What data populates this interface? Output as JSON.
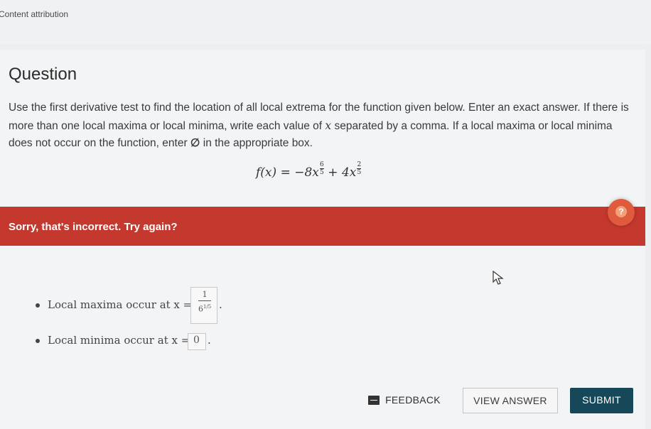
{
  "attribution": "Content attribution",
  "question": {
    "title": "Question",
    "body_1": "Use the first derivative test to find the location of all local extrema for the function given below. Enter an exact answer. If there is more than one local maxima or local minima, write each value of ",
    "body_var": "x",
    "body_2": " separated by a comma. If a local maxima or local minima does not occur on the function, enter ",
    "body_empty": "∅",
    "body_3": " in the appropriate box.",
    "formula": {
      "lhs": "f(x)",
      "eq": "=",
      "term1_coef": "−8x",
      "term1_exp_num": "6",
      "term1_exp_den": "5",
      "plus": "+",
      "term2_coef": "4x",
      "term2_exp_num": "2",
      "term2_exp_den": "5"
    }
  },
  "feedback": {
    "message": "Sorry, that's incorrect. Try again?",
    "help_label": "?"
  },
  "answers": {
    "maxima_label": "Local maxima occur at x =",
    "maxima_value_num": "1",
    "maxima_value_den": "6",
    "maxima_value_den_exp": "1/5",
    "maxima_suffix": ".",
    "minima_label": "Local minima occur at x =",
    "minima_value": "0",
    "minima_suffix": "."
  },
  "buttons": {
    "feedback": "FEEDBACK",
    "view_answer": "VIEW ANSWER",
    "submit": "SUBMIT"
  },
  "colors": {
    "error": "#c5382d",
    "submit": "#16485a"
  }
}
